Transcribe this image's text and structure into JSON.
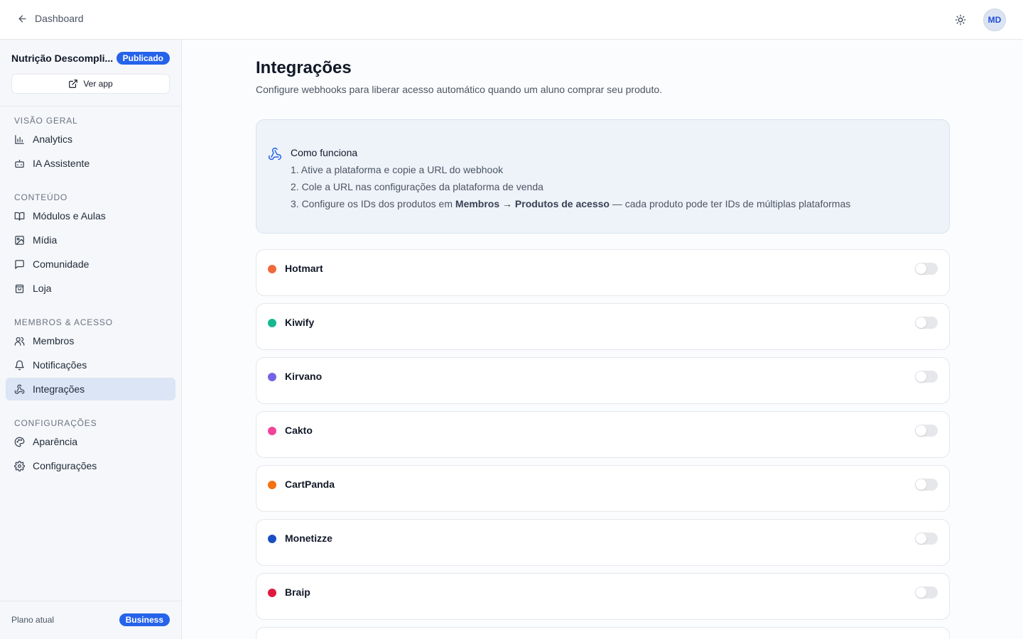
{
  "topbar": {
    "back_label": "Dashboard",
    "avatar_initials": "MD"
  },
  "sidebar": {
    "project_name": "Nutrição Descompli...",
    "status_badge": "Publicado",
    "view_app_label": "Ver app",
    "sections": [
      {
        "title": "VISÃO GERAL",
        "items": [
          {
            "label": "Analytics",
            "icon": "bar-chart-icon"
          },
          {
            "label": "IA Assistente",
            "icon": "bot-icon"
          }
        ]
      },
      {
        "title": "CONTEÚDO",
        "items": [
          {
            "label": "Módulos e Aulas",
            "icon": "book-icon"
          },
          {
            "label": "Mídia",
            "icon": "image-icon"
          },
          {
            "label": "Comunidade",
            "icon": "chat-icon"
          },
          {
            "label": "Loja",
            "icon": "shopping-bag-icon"
          }
        ]
      },
      {
        "title": "MEMBROS & ACESSO",
        "items": [
          {
            "label": "Membros",
            "icon": "users-icon"
          },
          {
            "label": "Notificações",
            "icon": "bell-icon"
          },
          {
            "label": "Integrações",
            "icon": "webhook-icon",
            "active": true
          }
        ]
      },
      {
        "title": "CONFIGURAÇÕES",
        "items": [
          {
            "label": "Aparência",
            "icon": "palette-icon"
          },
          {
            "label": "Configurações",
            "icon": "gear-icon"
          }
        ]
      }
    ],
    "plan_label": "Plano atual",
    "plan_badge": "Business"
  },
  "main": {
    "title": "Integrações",
    "subtitle": "Configure webhooks para liberar acesso automático quando um aluno comprar seu produto.",
    "info": {
      "title": "Como funciona",
      "step1": "1. Ative a plataforma e copie a URL do webhook",
      "step2": "2. Cole a URL nas configurações da plataforma de venda",
      "step3_prefix": "3. Configure os IDs dos produtos em ",
      "step3_bold1": "Membros",
      "step3_arrow": " → ",
      "step3_bold2": "Produtos de acesso",
      "step3_suffix": " — cada produto pode ter IDs de múltiplas plataformas"
    },
    "integrations": [
      {
        "name": "Hotmart",
        "color": "#f0693a",
        "enabled": false
      },
      {
        "name": "Kiwify",
        "color": "#16b890",
        "enabled": false
      },
      {
        "name": "Kirvano",
        "color": "#7364e6",
        "enabled": false
      },
      {
        "name": "Cakto",
        "color": "#f2449a",
        "enabled": false
      },
      {
        "name": "CartPanda",
        "color": "#f4720f",
        "enabled": false
      },
      {
        "name": "Monetizze",
        "color": "#1a4fc4",
        "enabled": false
      },
      {
        "name": "Braip",
        "color": "#e01840",
        "enabled": false
      }
    ]
  },
  "colors": {
    "accent": "#2563eb",
    "active_nav_bg": "#dbe5f5",
    "info_bg": "#eef3fa"
  }
}
